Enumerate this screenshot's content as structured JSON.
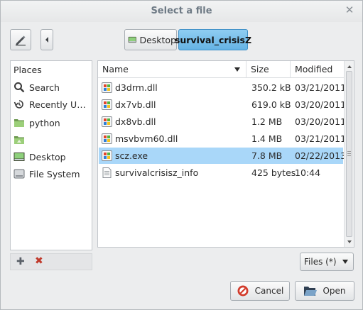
{
  "dialog": {
    "title": "Select a file"
  },
  "path_bar": {
    "segments": [
      {
        "label": "Desktop"
      },
      {
        "label": "survival_crisisZ"
      }
    ]
  },
  "places": {
    "header": "Places",
    "items": [
      {
        "label": "Search",
        "icon": "search-icon"
      },
      {
        "label": "Recently U…",
        "icon": "recent-icon"
      },
      {
        "label": "python",
        "icon": "folder-icon"
      },
      {
        "label": "",
        "icon": "folder-icon"
      },
      {
        "label": "Desktop",
        "icon": "desktop-icon"
      },
      {
        "label": "File System",
        "icon": "drive-icon"
      }
    ]
  },
  "file_list": {
    "columns": {
      "name": "Name",
      "size": "Size",
      "modified": "Modified"
    },
    "rows": [
      {
        "name": "d3drm.dll",
        "size": "350.2 kB",
        "modified": "03/21/2011",
        "icon": "executable-icon"
      },
      {
        "name": "dx7vb.dll",
        "size": "619.0 kB",
        "modified": "03/20/2011",
        "icon": "executable-icon"
      },
      {
        "name": "dx8vb.dll",
        "size": "1.2 MB",
        "modified": "03/20/2011",
        "icon": "executable-icon"
      },
      {
        "name": "msvbvm60.dll",
        "size": "1.4 MB",
        "modified": "03/21/2011",
        "icon": "executable-icon"
      },
      {
        "name": "scz.exe",
        "size": "7.8 MB",
        "modified": "02/22/2013",
        "icon": "executable-icon",
        "selected": true
      },
      {
        "name": "survivalcrisisz_info",
        "size": "425 bytes",
        "modified": "10:44",
        "icon": "text-file-icon"
      }
    ]
  },
  "filter": {
    "label": "Files (*)"
  },
  "buttons": {
    "cancel": "Cancel",
    "open": "Open"
  },
  "colors": {
    "selection": "#a9d7f9",
    "active_path": "#6fb8e6"
  }
}
